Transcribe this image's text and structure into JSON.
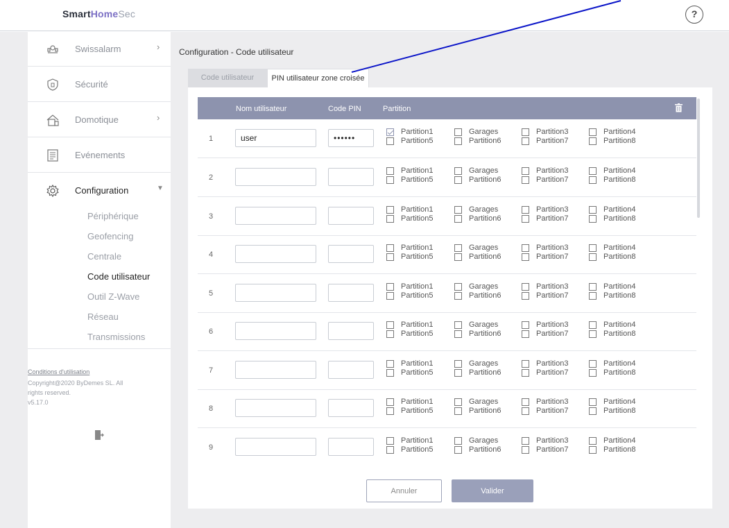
{
  "header": {
    "brand_part1": "Smart",
    "brand_part2": "Home",
    "brand_part3": "Sec",
    "help_label": "?"
  },
  "sidebar": {
    "items": [
      {
        "label": "Swissalarm",
        "icon": "devices-icon"
      },
      {
        "label": "Sécurité",
        "icon": "shield-icon"
      },
      {
        "label": "Domotique",
        "icon": "smart-home-icon"
      },
      {
        "label": "Evénements",
        "icon": "list-icon"
      },
      {
        "label": "Configuration",
        "icon": "gear-icon"
      }
    ],
    "sub_items": [
      "Périphérique",
      "Geofencing",
      "Centrale",
      "Code utilisateur",
      "Outil Z-Wave",
      "Réseau",
      "Transmissions"
    ],
    "active_sub": "Code utilisateur",
    "footer": {
      "terms_link": "Conditions d'utilisation",
      "copyright_line1": "Copyright@2020 ByDemes SL. All",
      "copyright_line2": "rights reserved.",
      "version": "v5.17.0"
    }
  },
  "main": {
    "title": "Configuration - Code utilisateur",
    "tabs": [
      {
        "label": "Code utilisateur",
        "active": false
      },
      {
        "label": "PIN utilisateur zone croisée",
        "active": true
      }
    ],
    "columns": {
      "name": "Nom utilisateur",
      "pin": "Code PIN",
      "partition": "Partition"
    },
    "partition_labels": [
      "Partition1",
      "Garages",
      "Partition3",
      "Partition4",
      "Partition5",
      "Partition6",
      "Partition7",
      "Partition8"
    ],
    "rows": [
      {
        "num": "1",
        "name": "user",
        "pin": "••••••",
        "checked": [
          true,
          false,
          false,
          false,
          false,
          false,
          false,
          false
        ]
      },
      {
        "num": "2",
        "name": "",
        "pin": "",
        "checked": [
          false,
          false,
          false,
          false,
          false,
          false,
          false,
          false
        ]
      },
      {
        "num": "3",
        "name": "",
        "pin": "",
        "checked": [
          false,
          false,
          false,
          false,
          false,
          false,
          false,
          false
        ]
      },
      {
        "num": "4",
        "name": "",
        "pin": "",
        "checked": [
          false,
          false,
          false,
          false,
          false,
          false,
          false,
          false
        ]
      },
      {
        "num": "5",
        "name": "",
        "pin": "",
        "checked": [
          false,
          false,
          false,
          false,
          false,
          false,
          false,
          false
        ]
      },
      {
        "num": "6",
        "name": "",
        "pin": "",
        "checked": [
          false,
          false,
          false,
          false,
          false,
          false,
          false,
          false
        ]
      },
      {
        "num": "7",
        "name": "",
        "pin": "",
        "checked": [
          false,
          false,
          false,
          false,
          false,
          false,
          false,
          false
        ]
      },
      {
        "num": "8",
        "name": "",
        "pin": "",
        "checked": [
          false,
          false,
          false,
          false,
          false,
          false,
          false,
          false
        ]
      },
      {
        "num": "9",
        "name": "",
        "pin": "",
        "checked": [
          false,
          false,
          false,
          false,
          false,
          false,
          false,
          false
        ]
      }
    ],
    "buttons": {
      "cancel": "Annuler",
      "submit": "Valider"
    }
  },
  "colors": {
    "table_header": "#8d93ae",
    "accent_purple": "#7b6fc4",
    "annotation_line": "#0a14c8",
    "background_gray": "#ededef"
  }
}
